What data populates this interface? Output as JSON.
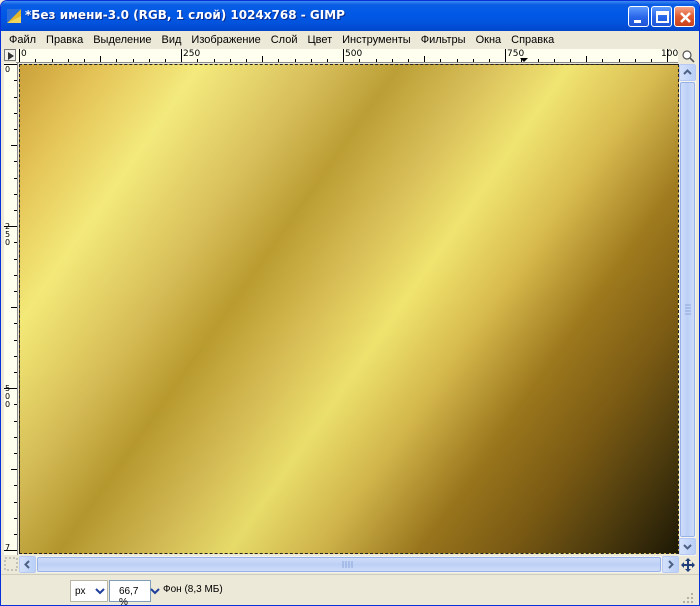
{
  "window": {
    "title": "*Без имени-3.0 (RGB, 1 слой) 1024x768 - GIMP"
  },
  "menu": [
    {
      "label": "Файл"
    },
    {
      "label": "Правка"
    },
    {
      "label": "Выделение"
    },
    {
      "label": "Вид"
    },
    {
      "label": "Изображение"
    },
    {
      "label": "Слой"
    },
    {
      "label": "Цвет"
    },
    {
      "label": "Инструменты"
    },
    {
      "label": "Фильтры"
    },
    {
      "label": "Окна"
    },
    {
      "label": "Справка"
    }
  ],
  "ruler": {
    "h_labels": [
      "0",
      "250",
      "500",
      "750",
      "100"
    ],
    "v_labels": [
      "0",
      "2 5 0",
      "5 0 0",
      "7"
    ]
  },
  "canvas": {
    "gradient_colors": [
      "#c89c30",
      "#f3e977",
      "#b99b2e",
      "#f0e46e",
      "#7f5e14",
      "#1f1a05"
    ]
  },
  "statusbar": {
    "unit": "px",
    "zoom": "66,7 %",
    "info": "Фон (8,3 МБ)"
  },
  "icons": {
    "window_controls": [
      "minimize-icon",
      "maximize-icon",
      "close-icon"
    ],
    "nav": "navigate-icon",
    "quickmask": "quickmask-icon",
    "zoom_nav": "zoom-icon"
  }
}
